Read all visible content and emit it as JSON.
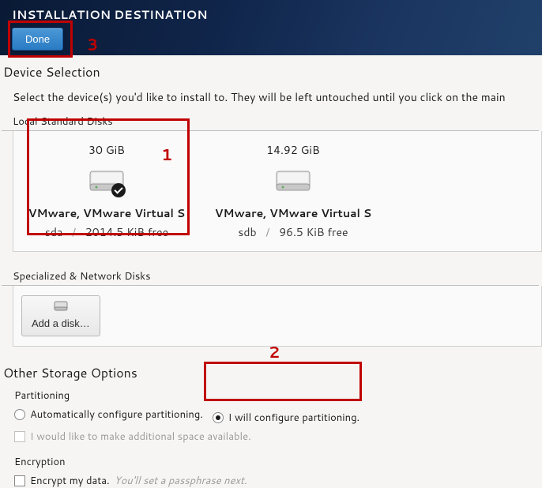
{
  "header": {
    "title": "INSTALLATION DESTINATION",
    "done_label": "Done"
  },
  "annotations": {
    "a1": "1",
    "a2": "2",
    "a3": "3"
  },
  "selection": {
    "title": "Device Selection",
    "instruction": "Select the device(s) you'd like to install to.   They will be left untouched until you click on the main"
  },
  "local_disks": {
    "label": "Local Standard Disks",
    "items": [
      {
        "size": "30 GiB",
        "name": "VMware, VMware Virtual S",
        "dev": "sda",
        "free": "2014.5 KiB free",
        "selected": true
      },
      {
        "size": "14.92 GiB",
        "name": "VMware, VMware Virtual S",
        "dev": "sdb",
        "free": "96.5 KiB free",
        "selected": false
      }
    ]
  },
  "specialized": {
    "label": "Specialized & Network Disks",
    "add_button": "Add a disk…"
  },
  "storage": {
    "title": "Other Storage Options",
    "partitioning_label": "Partitioning",
    "auto_label": "Automatically configure partitioning.",
    "manual_label": "I will configure partitioning.",
    "reclaim_label": "I would like to make additional space available.",
    "selected": "manual",
    "encryption_label": "Encryption",
    "encrypt_label": "Encrypt my data.",
    "encrypt_hint": "You'll set a passphrase next."
  }
}
